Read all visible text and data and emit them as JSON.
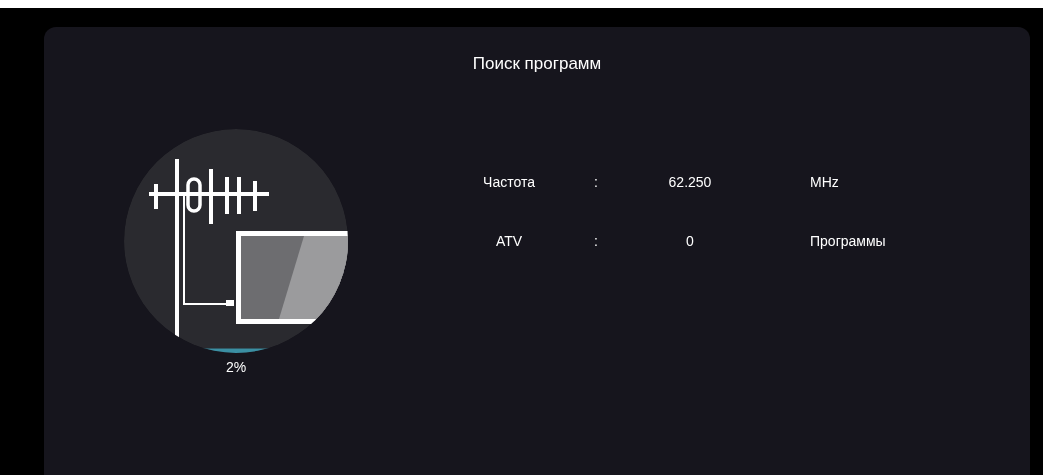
{
  "dialog": {
    "title": "Поиск программ"
  },
  "progress": {
    "level": 0.02,
    "reading": "2%"
  },
  "rows": [
    {
      "label": "Частота",
      "separator": ":",
      "value": "62.250",
      "unit": "MHz"
    },
    {
      "label": "ATV",
      "separator": ":",
      "value": "0",
      "unit": "Программы"
    }
  ]
}
